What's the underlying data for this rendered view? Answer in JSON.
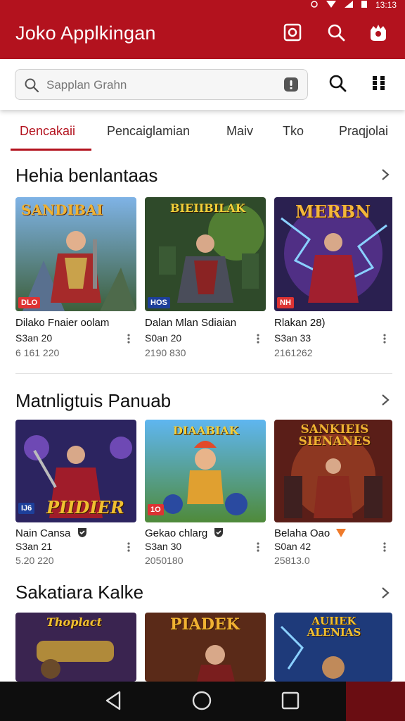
{
  "status": {
    "time": "13:13"
  },
  "app": {
    "title": "Joko Applkingan"
  },
  "search": {
    "placeholder": "Sapplan Grahn"
  },
  "tabs": [
    "Dencakaii",
    "Pencaiglamian",
    "Maiv",
    "Tko",
    "Praqjolai"
  ],
  "sections": [
    {
      "title": "Hehia benlantaas",
      "items": [
        {
          "art_title": "SANDIBAI",
          "badge": "DLO",
          "name": "Dilako Fnaier oolam",
          "line2": "S3an 20",
          "line3": "6 161 220"
        },
        {
          "art_title": "BIEIIBILAK",
          "badge": "HOS",
          "name": "Dalan Mlan Sdiaian",
          "line2": "S0an 20",
          "line3": "2190 830"
        },
        {
          "art_title": "MERBN",
          "badge": "NH",
          "name": "Rlakan 28)",
          "line2": "S3an 33",
          "line3": "2161262"
        }
      ]
    },
    {
      "title": "Matnligtuis Panuab",
      "items": [
        {
          "art_title": "PIIDIER",
          "badge": "IJ6",
          "name": "Nain Cansa",
          "line2": "S3an 21",
          "line3": "5.20 220"
        },
        {
          "art_title": "DIAABIAK",
          "badge": "1O",
          "name": "Gekao chlarg",
          "line2": "S3an 30",
          "line3": "2050180"
        },
        {
          "art_title": "SANKIEIS SIENANES",
          "badge": "",
          "name": "Belaha Oao",
          "line2": "S0an 42",
          "line3": "25813.0"
        }
      ]
    },
    {
      "title": "Sakatiara Kalke",
      "items": [
        {
          "art_title": "Thoplact",
          "badge": "",
          "name": "",
          "line2": "",
          "line3": ""
        },
        {
          "art_title": "PIADEK",
          "badge": "",
          "name": "",
          "line2": "",
          "line3": ""
        },
        {
          "art_title": "AUIIEK ALENIAS",
          "badge": "",
          "name": "",
          "line2": "",
          "line3": ""
        }
      ]
    }
  ],
  "colors": {
    "brand": "#b3121e",
    "navbar": "#0e0e0e"
  },
  "icons": [
    "camera-icon",
    "search-icon",
    "profile-icon",
    "mic-icon",
    "grid-icon",
    "chevron-right-icon",
    "more-vert-icon",
    "back-icon",
    "home-icon",
    "recents-icon",
    "verified-icon"
  ]
}
